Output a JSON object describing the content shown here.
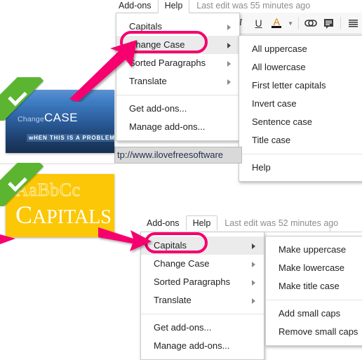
{
  "top_section": {
    "menubar": {
      "addons_label": "Add-ons",
      "help_label": "Help",
      "last_edit": "Last edit was 55 minutes ago"
    },
    "addons_menu": {
      "items": [
        {
          "label": "Capitals",
          "submenu": true,
          "highlighted": false
        },
        {
          "label": "Change Case",
          "submenu": true,
          "highlighted": true
        },
        {
          "label": "Sorted Paragraphs",
          "submenu": true,
          "highlighted": false
        },
        {
          "label": "Translate",
          "submenu": true,
          "highlighted": false
        }
      ],
      "footer_items": [
        {
          "label": "Get add-ons...",
          "submenu": false
        },
        {
          "label": "Manage add-ons...",
          "submenu": false
        }
      ]
    },
    "change_case_submenu": {
      "items": [
        {
          "label": "All uppercase"
        },
        {
          "label": "All lowercase"
        },
        {
          "label": "First letter capitals"
        },
        {
          "label": "Invert case"
        },
        {
          "label": "Sentence case"
        },
        {
          "label": "Title case"
        }
      ],
      "footer_items": [
        {
          "label": "Help"
        }
      ]
    },
    "toolbar": {
      "buttons": [
        {
          "name": "italic-icon",
          "glyph": "I"
        },
        {
          "name": "underline-icon",
          "glyph": "U"
        },
        {
          "name": "text-color-icon",
          "glyph": "A"
        },
        {
          "name": "text-color-dropdown-icon",
          "glyph": "▾"
        },
        {
          "name": "insert-link-icon",
          "glyph": "∞"
        },
        {
          "name": "add-comment-icon",
          "glyph": "☰"
        },
        {
          "name": "align-icon",
          "glyph": "☰"
        }
      ]
    },
    "url_text": "tp://www.ilovefreesoftware"
  },
  "cards": {
    "blue": {
      "badge": "check-mark",
      "title_small": "Change",
      "title_big": "CASE",
      "subtitle": "wHEN THIS IS A PROBLEM"
    },
    "yellow": {
      "badge": "check-mark",
      "sample_text": "AaBbCc",
      "title_first": "C",
      "title_rest": "APITALS"
    }
  },
  "bottom_section": {
    "menubar": {
      "addons_label": "Add-ons",
      "help_label": "Help",
      "last_edit": "Last edit was 52 minutes ago"
    },
    "addons_menu": {
      "items": [
        {
          "label": "Capitals",
          "submenu": true,
          "highlighted": true
        },
        {
          "label": "Change Case",
          "submenu": true,
          "highlighted": false
        },
        {
          "label": "Sorted Paragraphs",
          "submenu": true,
          "highlighted": false
        },
        {
          "label": "Translate",
          "submenu": true,
          "highlighted": false
        }
      ],
      "footer_items": [
        {
          "label": "Get add-ons...",
          "submenu": false
        },
        {
          "label": "Manage add-ons...",
          "submenu": false
        }
      ]
    },
    "capitals_submenu": {
      "items": [
        {
          "label": "Make uppercase"
        },
        {
          "label": "Make lowercase"
        },
        {
          "label": "Make title case"
        }
      ],
      "footer_items": [
        {
          "label": "Add small caps"
        },
        {
          "label": "Remove small caps"
        }
      ]
    }
  },
  "annotations": {
    "accent_color": "#f5006e",
    "check_color": "#5bb531",
    "highlight_color": "#ebebeb"
  }
}
